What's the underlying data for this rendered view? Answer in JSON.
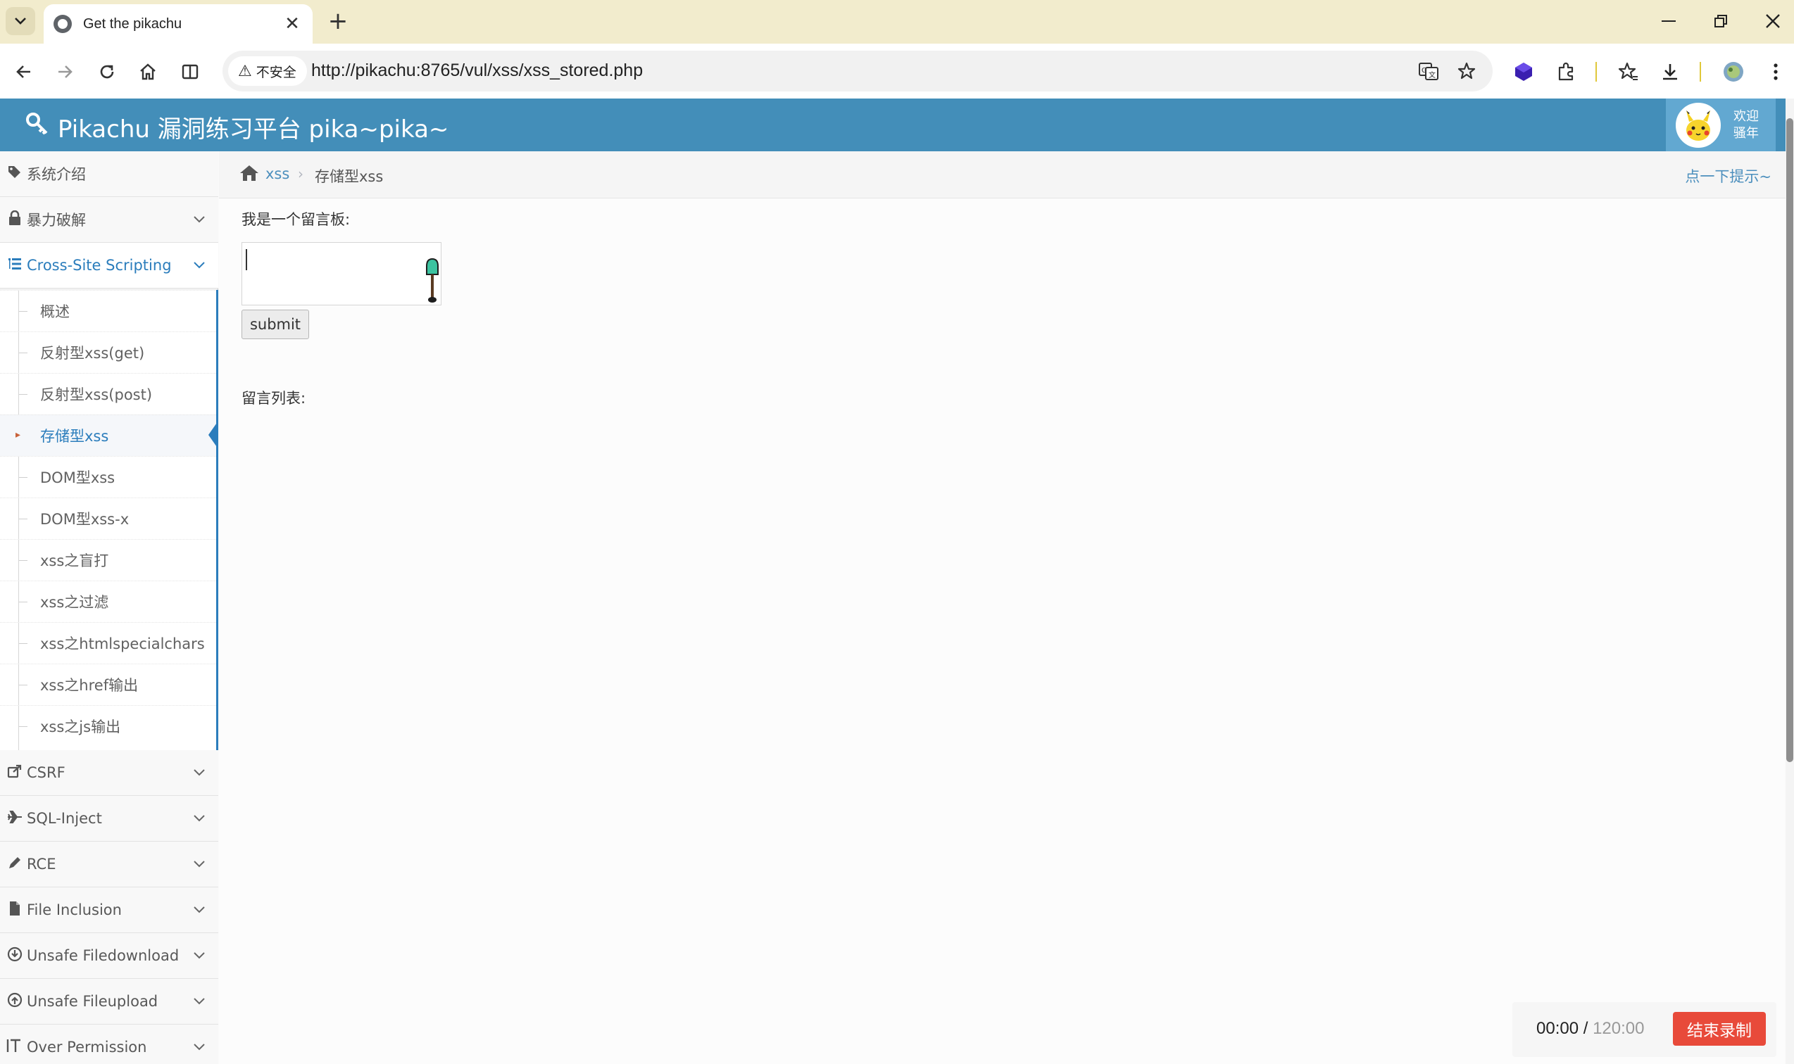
{
  "browser": {
    "tab_title": "Get the pikachu",
    "close_symbol": "✕",
    "new_tab_symbol": "+",
    "security_label": "不安全",
    "url": "http://pikachu:8765/vul/xss/xss_stored.php"
  },
  "header": {
    "title": "Pikachu 漏洞练习平台 pika~pika~",
    "welcome_line1": "欢迎",
    "welcome_line2": "骚年",
    "bg_color": "#438eb9"
  },
  "sidebar": {
    "items": [
      {
        "label": "系统介绍",
        "icon": "tags-icon"
      },
      {
        "label": "暴力破解",
        "icon": "lock-icon"
      },
      {
        "label": "Cross-Site Scripting",
        "icon": "list-icon"
      },
      {
        "label": "CSRF",
        "icon": "share-icon"
      },
      {
        "label": "SQL-Inject",
        "icon": "plane-icon"
      },
      {
        "label": "RCE",
        "icon": "pencil-icon"
      },
      {
        "label": "File Inclusion",
        "icon": "file-icon"
      },
      {
        "label": "Unsafe Filedownload",
        "icon": "download-icon"
      },
      {
        "label": "Unsafe Fileupload",
        "icon": "upload-icon"
      },
      {
        "label": "Over Permission",
        "icon": "text-height-icon"
      }
    ],
    "xss_subitems": [
      "概述",
      "反射型xss(get)",
      "反射型xss(post)",
      "存储型xss",
      "DOM型xss",
      "DOM型xss-x",
      "xss之盲打",
      "xss之过滤",
      "xss之htmlspecialchars",
      "xss之href输出",
      "xss之js输出"
    ],
    "active_color": "#2b7dbc"
  },
  "breadcrumb": {
    "link": "xss",
    "separator": "›",
    "current": "存储型xss",
    "hint": "点一下提示~"
  },
  "main": {
    "board_label": "我是一个留言板:",
    "message_value": "",
    "submit_label": "submit",
    "list_label": "留言列表:"
  },
  "recorder": {
    "elapsed": "00:00",
    "separator": " / ",
    "total": "120:00",
    "stop_label": "结束录制",
    "stop_color": "#e84a3a"
  }
}
